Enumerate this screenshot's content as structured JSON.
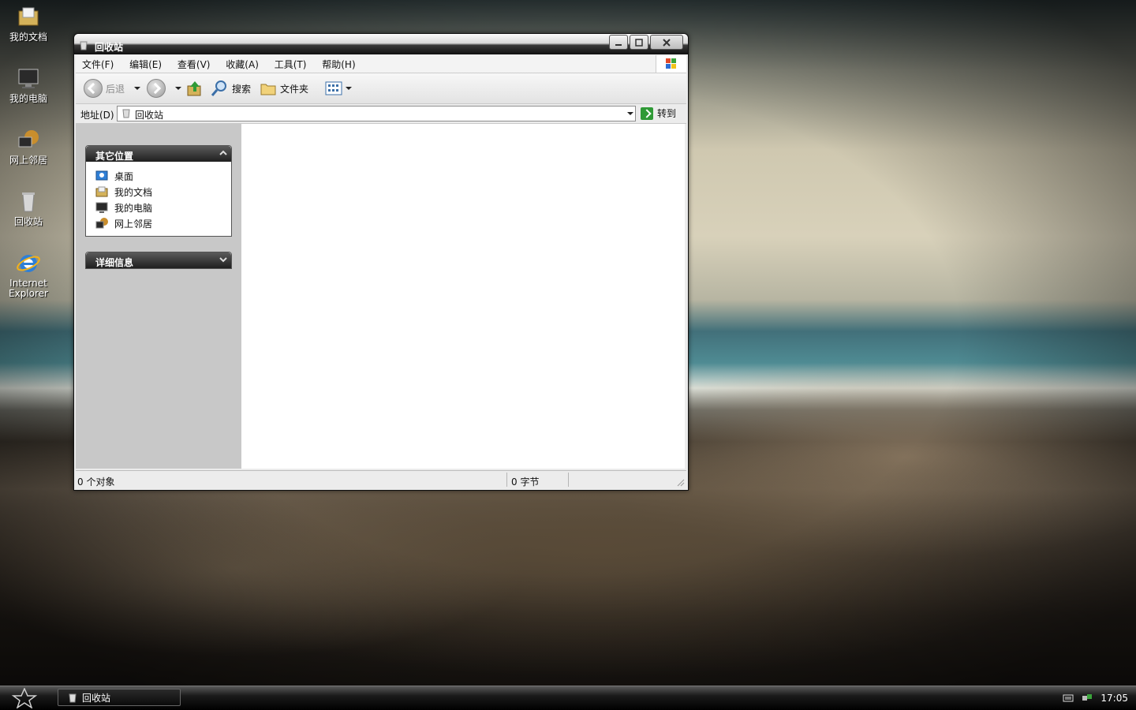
{
  "desktop": {
    "icons": [
      {
        "label": "我的文档"
      },
      {
        "label": "我的电脑"
      },
      {
        "label": "网上邻居"
      },
      {
        "label": "回收站"
      },
      {
        "label": "Internet Explorer"
      }
    ]
  },
  "window": {
    "title": "回收站",
    "menu": [
      "文件(F)",
      "编辑(E)",
      "查看(V)",
      "收藏(A)",
      "工具(T)",
      "帮助(H)"
    ],
    "toolbar": {
      "back": "后退",
      "search": "搜索",
      "folders": "文件夹"
    },
    "address": {
      "label": "地址(D)",
      "value": "回收站",
      "go": "转到"
    },
    "sidebar": {
      "other_places": {
        "title": "其它位置",
        "items": [
          "桌面",
          "我的文档",
          "我的电脑",
          "网上邻居"
        ]
      },
      "details": {
        "title": "详细信息"
      }
    },
    "status": {
      "objects": "0 个对象",
      "size": "0 字节"
    }
  },
  "taskbar": {
    "task_label": "回收站",
    "clock": "17:05"
  },
  "colors": {
    "accent_green": "#2f9a36",
    "titlebar_dark": "#111111"
  }
}
